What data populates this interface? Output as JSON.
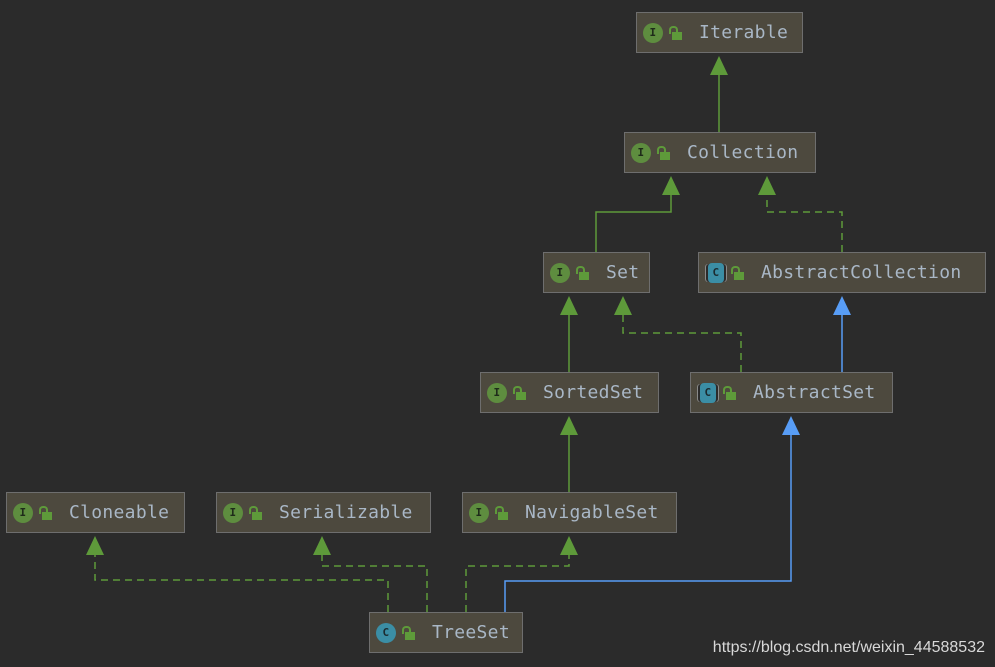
{
  "nodes": [
    {
      "id": "iterable",
      "name": "Iterable",
      "kind": "interface",
      "badge": "I"
    },
    {
      "id": "collection",
      "name": "Collection",
      "kind": "interface",
      "badge": "I"
    },
    {
      "id": "set",
      "name": "Set",
      "kind": "interface",
      "badge": "I"
    },
    {
      "id": "abstractcollection",
      "name": "AbstractCollection",
      "kind": "abstract-class",
      "badge": "C"
    },
    {
      "id": "sortedset",
      "name": "SortedSet",
      "kind": "interface",
      "badge": "I"
    },
    {
      "id": "abstractset",
      "name": "AbstractSet",
      "kind": "abstract-class",
      "badge": "C"
    },
    {
      "id": "cloneable",
      "name": "Cloneable",
      "kind": "interface",
      "badge": "I"
    },
    {
      "id": "serializable",
      "name": "Serializable",
      "kind": "interface",
      "badge": "I"
    },
    {
      "id": "navigableset",
      "name": "NavigableSet",
      "kind": "interface",
      "badge": "I"
    },
    {
      "id": "treeset",
      "name": "TreeSet",
      "kind": "class",
      "badge": "C"
    }
  ],
  "edges": [
    {
      "from": "Collection",
      "to": "Iterable",
      "type": "extends"
    },
    {
      "from": "Set",
      "to": "Collection",
      "type": "extends"
    },
    {
      "from": "AbstractCollection",
      "to": "Collection",
      "type": "implements"
    },
    {
      "from": "SortedSet",
      "to": "Set",
      "type": "extends"
    },
    {
      "from": "AbstractSet",
      "to": "Set",
      "type": "implements"
    },
    {
      "from": "AbstractSet",
      "to": "AbstractCollection",
      "type": "class-extends"
    },
    {
      "from": "NavigableSet",
      "to": "SortedSet",
      "type": "extends"
    },
    {
      "from": "TreeSet",
      "to": "Cloneable",
      "type": "implements"
    },
    {
      "from": "TreeSet",
      "to": "Serializable",
      "type": "implements"
    },
    {
      "from": "TreeSet",
      "to": "NavigableSet",
      "type": "implements"
    },
    {
      "from": "TreeSet",
      "to": "AbstractSet",
      "type": "class-extends"
    }
  ],
  "colors": {
    "background": "#2b2b2b",
    "node": "#4d493e",
    "interface_edge": "#5e9a3a",
    "class_edge": "#589df6",
    "interface_badge": "#5e8d3f",
    "class_badge": "#3b8ea5"
  },
  "watermark": "https://blog.csdn.net/weixin_44588532"
}
